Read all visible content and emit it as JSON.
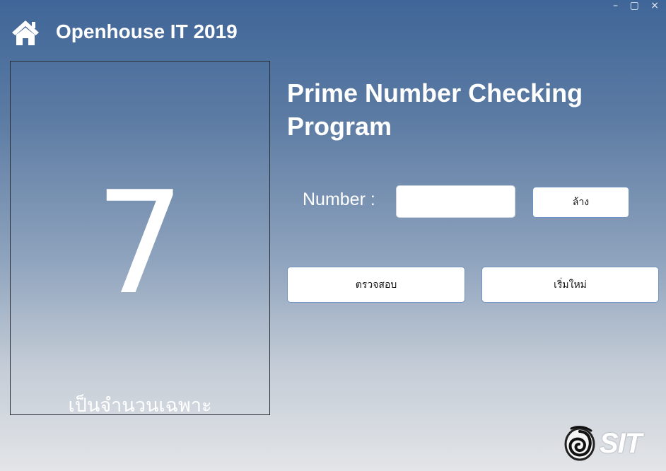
{
  "window": {
    "controls": "– ▢ ×"
  },
  "header": {
    "title": "Openhouse IT 2019",
    "icon": "home-icon"
  },
  "result": {
    "number": "7",
    "message": "เป็นจำนวนเฉพาะ"
  },
  "main": {
    "heading": "Prime Number Checking Program",
    "number_label": "Number :",
    "number_value": "",
    "clear_label": "ล้าง",
    "check_label": "ตรวจสอบ",
    "restart_label": "เริ่มใหม่"
  },
  "logo": {
    "text": "SIT",
    "icon": "sit-emblem-icon"
  },
  "colors": {
    "bg_top": "#3f6698",
    "bg_bottom": "#e3e5e8",
    "button_border": "#6f93c4"
  }
}
